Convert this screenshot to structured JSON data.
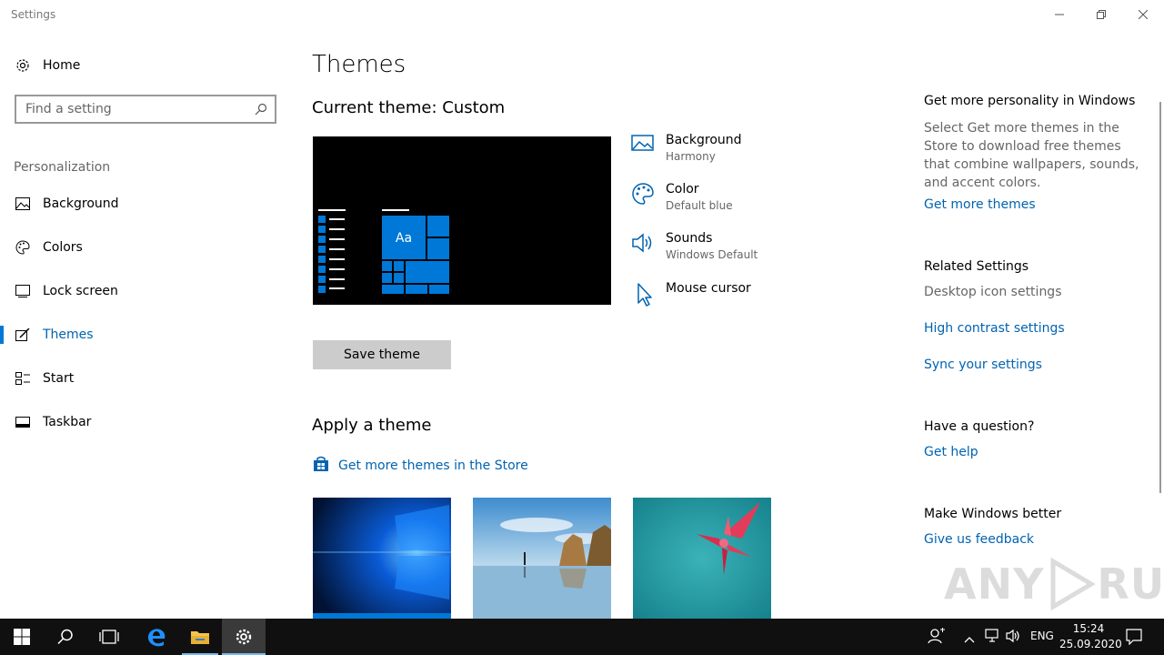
{
  "window": {
    "title": "Settings"
  },
  "sidebar": {
    "home_label": "Home",
    "search_placeholder": "Find a setting",
    "section_title": "Personalization",
    "items": [
      {
        "label": "Background",
        "icon": "picture-icon"
      },
      {
        "label": "Colors",
        "icon": "palette-icon"
      },
      {
        "label": "Lock screen",
        "icon": "lock-screen-icon"
      },
      {
        "label": "Themes",
        "icon": "themes-icon",
        "active": true
      },
      {
        "label": "Start",
        "icon": "start-icon"
      },
      {
        "label": "Taskbar",
        "icon": "taskbar-icon"
      }
    ]
  },
  "main": {
    "page_title": "Themes",
    "current_theme_label": "Current theme: Custom",
    "preview_tile_text": "Aa",
    "settings": [
      {
        "title": "Background",
        "subtitle": "Harmony",
        "icon": "picture-icon"
      },
      {
        "title": "Color",
        "subtitle": "Default blue",
        "icon": "palette-icon"
      },
      {
        "title": "Sounds",
        "subtitle": "Windows Default",
        "icon": "speaker-icon"
      },
      {
        "title": "Mouse cursor",
        "subtitle": "",
        "icon": "cursor-icon"
      }
    ],
    "save_button": "Save theme",
    "apply_heading": "Apply a theme",
    "store_link": "Get more themes in the Store",
    "themes": [
      {
        "name": "windows-10",
        "selected": true
      },
      {
        "name": "beach"
      },
      {
        "name": "flower"
      }
    ]
  },
  "right_panel": {
    "personality_heading": "Get more personality in Windows",
    "personality_text": "Select Get more themes in the Store to download free themes that combine wallpapers, sounds, and accent colors.",
    "get_more_themes": "Get more themes",
    "related_heading": "Related Settings",
    "desktop_icon_settings": "Desktop icon settings",
    "high_contrast": "High contrast settings",
    "sync": "Sync your settings",
    "question_heading": "Have a question?",
    "get_help": "Get help",
    "better_heading": "Make Windows better",
    "feedback": "Give us feedback"
  },
  "watermark": {
    "text_left": "ANY",
    "text_right": "RUN"
  },
  "taskbar": {
    "language": "ENG",
    "time": "15:24",
    "date": "25.09.2020"
  },
  "colors": {
    "accent": "#0078d7",
    "link": "#0063b1",
    "taskbar": "#101010"
  }
}
